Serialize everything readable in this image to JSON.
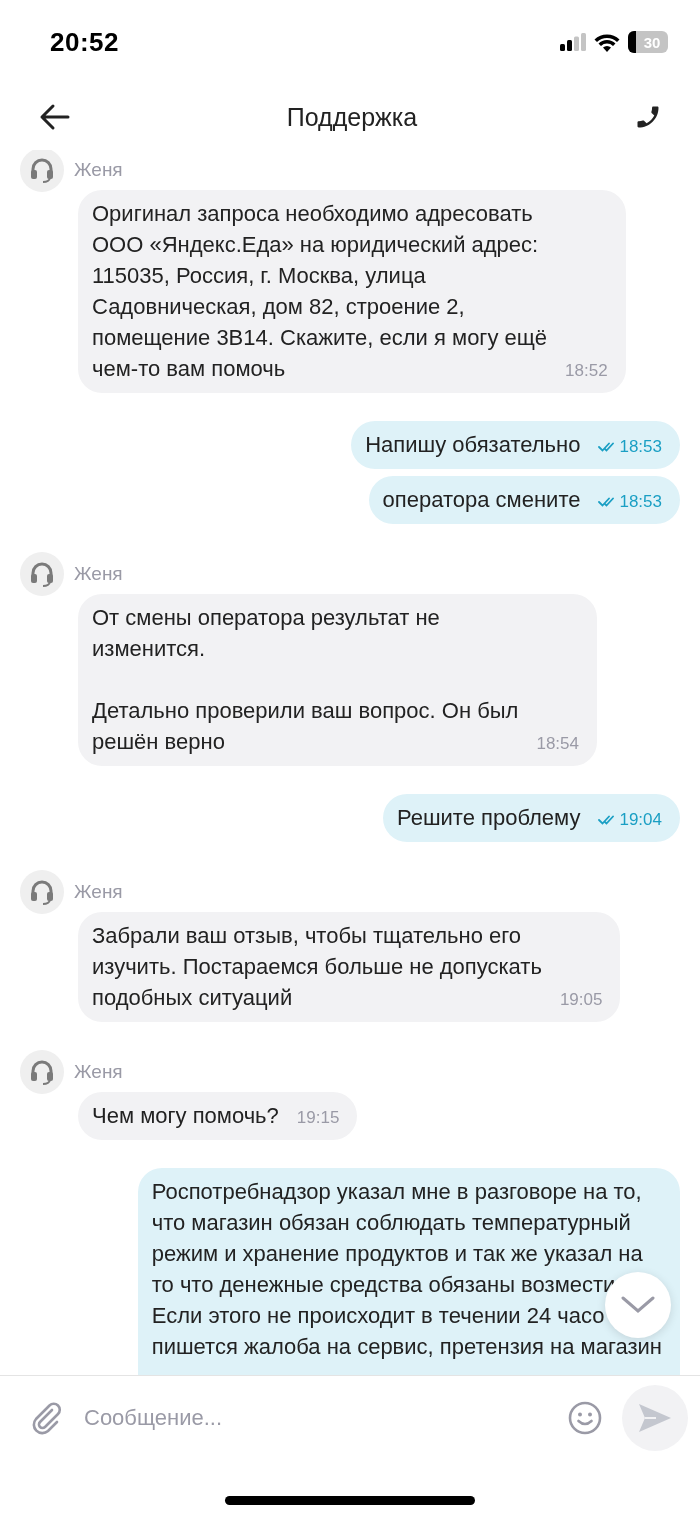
{
  "status_bar": {
    "time": "20:52",
    "battery": "30"
  },
  "header": {
    "title": "Поддержка"
  },
  "messages": [
    {
      "kind": "incoming",
      "author": "Женя",
      "text": "Оригинал запроса необходимо адресовать\nООО «Яндекс.Еда» на юридический адрес:\n115035, Россия, г. Москва, улица\nСадовническая, дом 82, строение 2,\nпомещение 3В14. Скажите, если я могу ещё\nчем-то вам помочь",
      "time": "18:52"
    },
    {
      "kind": "outgoing",
      "text": "Напишу обязательно",
      "time": "18:53",
      "read": true
    },
    {
      "kind": "outgoing",
      "text": "оператора смените",
      "time": "18:53",
      "read": true
    },
    {
      "kind": "incoming",
      "author": "Женя",
      "text": "От смены оператора результат не\nизменится.\n\nДетально проверили ваш вопрос. Он был\nрешён верно",
      "time": "18:54"
    },
    {
      "kind": "outgoing",
      "text": "Решите проблему",
      "time": "19:04",
      "read": true
    },
    {
      "kind": "incoming",
      "author": "Женя",
      "text": "Забрали ваш отзыв, чтобы тщательно его\nизучить. Постараемся больше не допускать\nподобных ситуаций",
      "time": "19:05"
    },
    {
      "kind": "incoming",
      "author": "Женя",
      "text": "Чем могу помочь?",
      "time": "19:15"
    },
    {
      "kind": "outgoing",
      "lines": [
        "Роспотребнадзор указал мне в разговоре на то,",
        "что магазин обязан соблюдать температурный",
        "режим и хранение продуктов и так же указал на",
        "то что денежные средства обязаны возмести",
        "Если этого не происходит в течении 24 часо",
        "пишется жалоба на сервис, претензия на магазин"
      ]
    }
  ],
  "composer": {
    "placeholder": "Сообщение..."
  }
}
